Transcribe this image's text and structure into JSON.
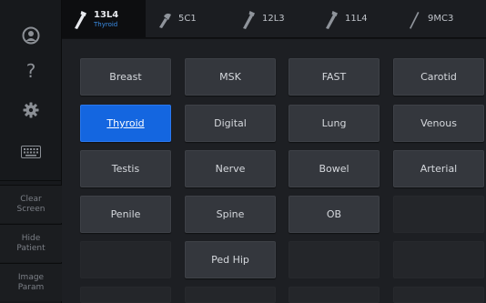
{
  "sidebar": {
    "user_icon": "user-icon",
    "help_icon": "help-icon",
    "help_glyph": "?",
    "settings_icon": "gear-icon",
    "keyboard_icon": "keyboard-icon",
    "buttons": [
      "Clear\nScreen",
      "Hide\nPatient",
      "Image\nParam"
    ]
  },
  "tabs": [
    {
      "name": "13L4",
      "sub": "Thyroid",
      "active": true
    },
    {
      "name": "5C1",
      "sub": "",
      "active": false
    },
    {
      "name": "12L3",
      "sub": "",
      "active": false
    },
    {
      "name": "11L4",
      "sub": "",
      "active": false
    },
    {
      "name": "9MC3",
      "sub": "",
      "active": false
    }
  ],
  "presets": [
    [
      "Breast",
      "MSK",
      "FAST",
      "Carotid"
    ],
    [
      "Thyroid",
      "Digital",
      "Lung",
      "Venous"
    ],
    [
      "Testis",
      "Nerve",
      "Bowel",
      "Arterial"
    ],
    [
      "Penile",
      "Spine",
      "OB",
      ""
    ],
    [
      "",
      "Ped Hip",
      "",
      ""
    ]
  ],
  "selected_preset": "Thyroid",
  "colors": {
    "accent": "#1466e0",
    "sub_label": "#3b8fe8"
  }
}
